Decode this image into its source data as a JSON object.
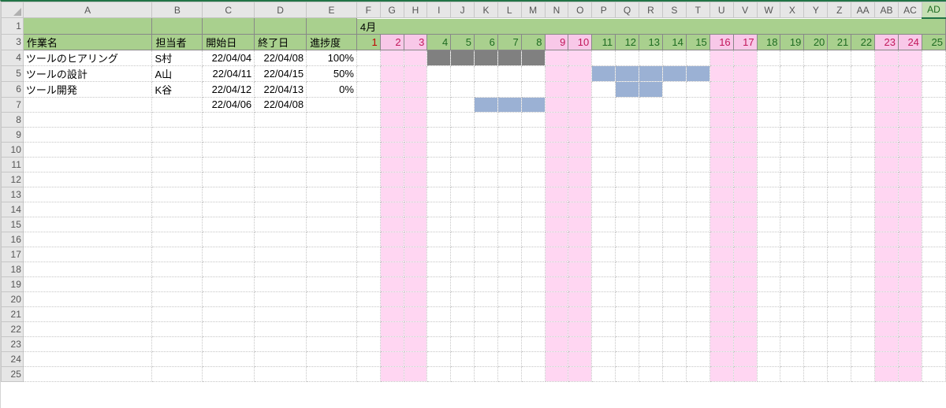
{
  "columns": [
    "A",
    "B",
    "C",
    "D",
    "E",
    "F",
    "G",
    "H",
    "I",
    "J",
    "K",
    "L",
    "M",
    "N",
    "O",
    "P",
    "Q",
    "R",
    "S",
    "T",
    "U",
    "V",
    "W",
    "X",
    "Y",
    "Z",
    "AA",
    "AB",
    "AC",
    "AD"
  ],
  "selectedCol": "AD",
  "visibleRowStart": 1,
  "visibleRowEnd": 25,
  "hiddenRows": [
    2
  ],
  "monthLabel": "4月",
  "headers": {
    "A": "作業名",
    "B": "担当者",
    "C": "開始日",
    "D": "終了日",
    "E": "進捗度"
  },
  "days": [
    {
      "n": 1,
      "wknd": false
    },
    {
      "n": 2,
      "wknd": true
    },
    {
      "n": 3,
      "wknd": true
    },
    {
      "n": 4,
      "wknd": false
    },
    {
      "n": 5,
      "wknd": false
    },
    {
      "n": 6,
      "wknd": false
    },
    {
      "n": 7,
      "wknd": false
    },
    {
      "n": 8,
      "wknd": false
    },
    {
      "n": 9,
      "wknd": true
    },
    {
      "n": 10,
      "wknd": true
    },
    {
      "n": 11,
      "wknd": false
    },
    {
      "n": 12,
      "wknd": false
    },
    {
      "n": 13,
      "wknd": false
    },
    {
      "n": 14,
      "wknd": false
    },
    {
      "n": 15,
      "wknd": false
    },
    {
      "n": 16,
      "wknd": true
    },
    {
      "n": 17,
      "wknd": true
    },
    {
      "n": 18,
      "wknd": false
    },
    {
      "n": 19,
      "wknd": false
    },
    {
      "n": 20,
      "wknd": false
    },
    {
      "n": 21,
      "wknd": false
    },
    {
      "n": 22,
      "wknd": false
    },
    {
      "n": 23,
      "wknd": true
    },
    {
      "n": 24,
      "wknd": true
    },
    {
      "n": 25,
      "wknd": false
    }
  ],
  "todayDay": 1,
  "tasks": [
    {
      "name": "ツールのヒアリング",
      "owner": "S村",
      "start": "22/04/04",
      "end": "22/04/08",
      "progress": "100%",
      "barFrom": 4,
      "barTo": 8,
      "barStyle": "bar1"
    },
    {
      "name": "ツールの設計",
      "owner": "A山",
      "start": "22/04/11",
      "end": "22/04/15",
      "progress": "50%",
      "barFrom": 11,
      "barTo": 15,
      "barStyle": "bar2"
    },
    {
      "name": "ツール開発",
      "owner": "K谷",
      "start": "22/04/12",
      "end": "22/04/13",
      "progress": "0%",
      "barFrom": 12,
      "barTo": 13,
      "barStyle": "bar2"
    },
    {
      "name": "",
      "owner": "",
      "start": "22/04/06",
      "end": "22/04/08",
      "progress": "",
      "barFrom": 6,
      "barTo": 8,
      "barStyle": "bar2"
    }
  ],
  "chart_data": {
    "type": "table",
    "title": "Gantt schedule (4月)",
    "columns": [
      "作業名",
      "担当者",
      "開始日",
      "終了日",
      "進捗度"
    ],
    "rows": [
      [
        "ツールのヒアリング",
        "S村",
        "22/04/04",
        "22/04/08",
        "100%"
      ],
      [
        "ツールの設計",
        "A山",
        "22/04/11",
        "22/04/15",
        "50%"
      ],
      [
        "ツール開発",
        "K谷",
        "22/04/12",
        "22/04/13",
        "0%"
      ],
      [
        "",
        "",
        "22/04/06",
        "22/04/08",
        ""
      ]
    ],
    "gantt": {
      "x_unit": "day",
      "x_range": [
        1,
        25
      ],
      "weekend_days": [
        2,
        3,
        9,
        10,
        16,
        17,
        23,
        24
      ],
      "bars": [
        {
          "label": "ツールのヒアリング",
          "from": 4,
          "to": 8,
          "color": "#808080"
        },
        {
          "label": "ツールの設計",
          "from": 11,
          "to": 15,
          "color": "#9bb1d4"
        },
        {
          "label": "ツール開発",
          "from": 12,
          "to": 13,
          "color": "#9bb1d4"
        },
        {
          "label": "",
          "from": 6,
          "to": 8,
          "color": "#9bb1d4"
        }
      ]
    }
  }
}
